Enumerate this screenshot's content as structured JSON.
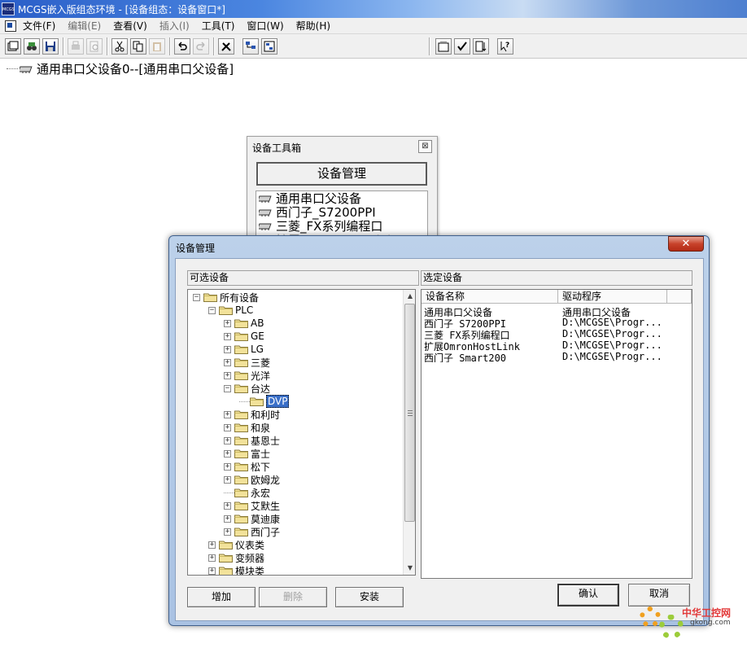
{
  "window": {
    "app_icon_text": "MCGS",
    "title": "MCGS嵌入版组态环境 - [设备组态：设备窗口*]"
  },
  "menu": [
    {
      "label": "文件(F)",
      "enabled": true
    },
    {
      "label": "编辑(E)",
      "enabled": false
    },
    {
      "label": "查看(V)",
      "enabled": true
    },
    {
      "label": "插入(I)",
      "enabled": false
    },
    {
      "label": "工具(T)",
      "enabled": true
    },
    {
      "label": "窗口(W)",
      "enabled": true
    },
    {
      "label": "帮助(H)",
      "enabled": true
    }
  ],
  "canvas": {
    "root_device": "通用串口父设备0--[通用串口父设备]"
  },
  "toolbox": {
    "title": "设备工具箱",
    "close_glyph": "⊠",
    "manage_button": "设备管理",
    "items": [
      "通用串口父设备",
      "西门子_S7200PPI",
      "三菱_FX系列编程口",
      "扩展OmronHostLink",
      "西门子_Smart200"
    ]
  },
  "dialog": {
    "title": "设备管理",
    "close_glyph": "✕",
    "left_header": "可选设备",
    "right_header": "选定设备",
    "tree": [
      {
        "label": "所有设备",
        "expander": "−",
        "level": 0
      },
      {
        "label": "PLC",
        "expander": "−",
        "level": 1
      },
      {
        "label": "AB",
        "expander": "+",
        "level": 2
      },
      {
        "label": "GE",
        "expander": "+",
        "level": 2
      },
      {
        "label": "LG",
        "expander": "+",
        "level": 2
      },
      {
        "label": "三菱",
        "expander": "+",
        "level": 2
      },
      {
        "label": "光洋",
        "expander": "+",
        "level": 2
      },
      {
        "label": "台达",
        "expander": "−",
        "level": 2
      },
      {
        "label": "DVP",
        "expander": "",
        "level": 3,
        "selected": true
      },
      {
        "label": "和利时",
        "expander": "+",
        "level": 2
      },
      {
        "label": "和泉",
        "expander": "+",
        "level": 2
      },
      {
        "label": "基恩士",
        "expander": "+",
        "level": 2
      },
      {
        "label": "富士",
        "expander": "+",
        "level": 2
      },
      {
        "label": "松下",
        "expander": "+",
        "level": 2
      },
      {
        "label": "欧姆龙",
        "expander": "+",
        "level": 2
      },
      {
        "label": "永宏",
        "expander": "",
        "level": 2
      },
      {
        "label": "艾默生",
        "expander": "+",
        "level": 2
      },
      {
        "label": "莫迪康",
        "expander": "+",
        "level": 2
      },
      {
        "label": "西门子",
        "expander": "+",
        "level": 2
      },
      {
        "label": "仪表类",
        "expander": "+",
        "level": 1
      },
      {
        "label": "变频器",
        "expander": "+",
        "level": 1
      },
      {
        "label": "模块类",
        "expander": "+",
        "level": 1
      }
    ],
    "columns": [
      "设备名称",
      "驱动程序"
    ],
    "selected_devices": [
      {
        "name": "通用串口父设备",
        "driver": "通用串口父设备"
      },
      {
        "name": "西门子_S7200PPI",
        "driver": "D:\\MCGSE\\Progr..."
      },
      {
        "name": "三菱_FX系列编程口",
        "driver": "D:\\MCGSE\\Progr..."
      },
      {
        "name": "扩展OmronHostLink",
        "driver": "D:\\MCGSE\\Progr..."
      },
      {
        "name": "西门子_Smart200",
        "driver": "D:\\MCGSE\\Progr..."
      }
    ],
    "buttons": {
      "add": "增加",
      "delete": "删除",
      "install": "安装",
      "ok": "确认",
      "cancel": "取消"
    }
  },
  "watermark": {
    "site_name": "中华工控网",
    "url": "gkong.com"
  },
  "colors": {
    "selection": "#3a6fc8",
    "dialog_frame": "#bcd1ea",
    "close_button": "#c8432b"
  }
}
